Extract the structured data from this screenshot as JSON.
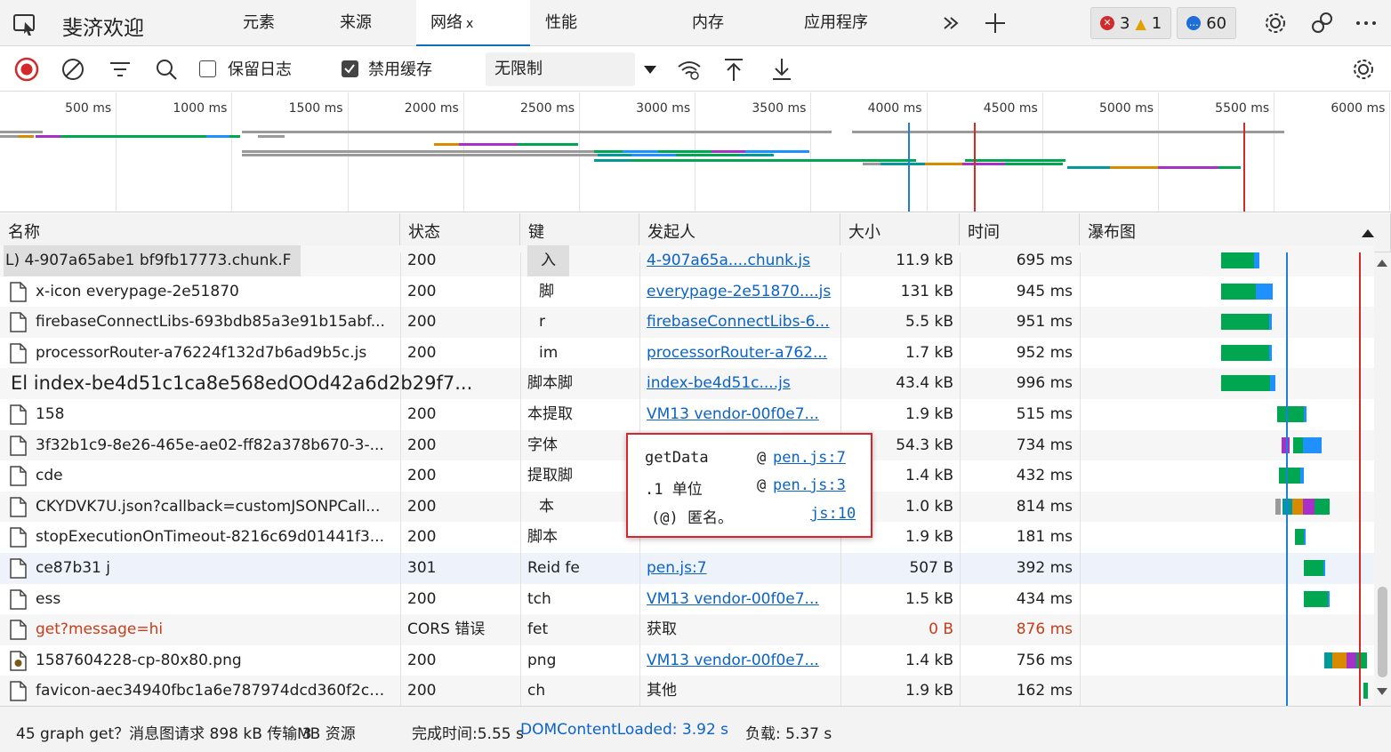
{
  "tabbar": {
    "welcome": "斐济欢迎",
    "tabs": [
      {
        "label": "元素"
      },
      {
        "label": "来源"
      },
      {
        "label": "网络",
        "close": "x"
      },
      {
        "label": "性能"
      },
      {
        "label": "内存"
      },
      {
        "label": "应用程序"
      }
    ],
    "errors": "3",
    "warnings": "1",
    "messages": "60"
  },
  "toolbar": {
    "preserve_log": "保留日志",
    "disable_cache": "禁用缓存",
    "throttling": "无限制"
  },
  "overview": {
    "ticks": [
      "500 ms",
      "1000 ms",
      "1500 ms",
      "2000 ms",
      "2500 ms",
      "3000 ms",
      "3500 ms",
      "4000 ms",
      "4500 ms",
      "5000 ms",
      "5500 ms",
      "6000 ms"
    ]
  },
  "columns": [
    "名称",
    "状态",
    "键",
    "发起人",
    "大小",
    "时间",
    "瀑布图"
  ],
  "rows": [
    {
      "name": "L) 4-907a65abe1 bf9fb17773.chunk.F",
      "status": "200",
      "type": "入",
      "initiator": "4-907a65a....chunk.js",
      "size": "11.9 kB",
      "time": "695 ms"
    },
    {
      "name": "x-icon everypage-2e51870",
      "status": "200",
      "type": "脚",
      "initiator": "everypage-2e51870....js",
      "size": "131 kB",
      "time": "945 ms"
    },
    {
      "name": "firebaseConnectLibs-693bdb85a3e91b15abf...",
      "status": "200",
      "type": "r",
      "initiator": "firebaseConnectLibs-6...",
      "size": "5.5 kB",
      "time": "951 ms"
    },
    {
      "name": "processorRouter-a76224f132d7b6ad9b5c.js",
      "status": "200",
      "type": "im",
      "initiator": "processorRouter-a762...",
      "size": "1.7 kB",
      "time": "952 ms"
    },
    {
      "name": "El index-be4d51c1ca8e568edOOd42a6d2b29f7...",
      "status": "",
      "type": "脚本脚",
      "initiator": "index-be4d51c....js",
      "size": "43.4 kB",
      "time": "996 ms"
    },
    {
      "name": "158",
      "status": "200",
      "type": "本提取",
      "initiator": "VM13 vendor-00f0e7...",
      "size": "1.9 kB",
      "time": "515 ms"
    },
    {
      "name": "3f32b1c9-8e26-465e-ae02-ff82a378b670-3-...",
      "status": "200",
      "type": "字体",
      "initiator": "",
      "size": "54.3 kB",
      "time": "734 ms"
    },
    {
      "name": "cde",
      "status": "200",
      "type": "提取脚",
      "initiator": "",
      "size": "1.4 kB",
      "time": "432 ms"
    },
    {
      "name": "CKYDVK7U.json?callback=customJSONPCall...",
      "status": "200",
      "type": "本",
      "initiator": "",
      "size": "1.0 kB",
      "time": "814 ms"
    },
    {
      "name": "stopExecutionOnTimeout-8216c69d01441f3...",
      "status": "200",
      "type": "脚本",
      "initiator": "",
      "size": "1.9 kB",
      "time": "181 ms"
    },
    {
      "name": "ce87b31 j",
      "status": "301",
      "type": "Reid fe",
      "initiator": "pen.js:7",
      "size": "507 B",
      "time": "392 ms"
    },
    {
      "name": "ess",
      "status": "200",
      "type": "tch",
      "initiator": "VM13 vendor-00f0e7...",
      "size": "1.5 kB",
      "time": "434 ms"
    },
    {
      "name": "get?message=hi",
      "status": "CORS 错误",
      "type": "fet",
      "initiator": "获取",
      "size": "0 B",
      "time": "876 ms"
    },
    {
      "name": "1587604228-cp-80x80.png",
      "status": "200",
      "type": "png",
      "initiator": "VM13 vendor-00f0e7...",
      "size": "1.4 kB",
      "time": "756 ms"
    },
    {
      "name": "favicon-aec34940fbc1a6e787974dcd360f2c6...",
      "status": "200",
      "type": "ch",
      "initiator": "其他",
      "size": "1.9 kB",
      "time": "162 ms"
    }
  ],
  "tooltip": {
    "l1_fn": "getData",
    "l1_at": "@",
    "l1_loc": "pen.js:7",
    "l2_fn": ".1 单位",
    "l2_at": "@",
    "l2_loc": "pen.js:3",
    "l3_fn": "(@) 匿名。",
    "l3_loc": "js:10"
  },
  "status": {
    "requests": "45 graph get？消息图请求 898 kB 传输 3",
    "resources": "MB 资源",
    "finish": "完成时间:5.55 s",
    "dcl": "DOMContentLoaded: 3.92 s",
    "load": "负载: 5.37 s"
  },
  "colors": {
    "accent": "#0f6cbd",
    "link": "#0b63c5",
    "error": "#c43e1c",
    "bar_green": "#00a650",
    "bar_blue": "#1e90ff",
    "bar_teal": "#009a9a",
    "bar_orange": "#d88a00",
    "bar_purple": "#a630c8",
    "bar_gray": "#9a9a9a",
    "dcl_line": "#1e7fd8",
    "load_line": "#d12a2a"
  }
}
